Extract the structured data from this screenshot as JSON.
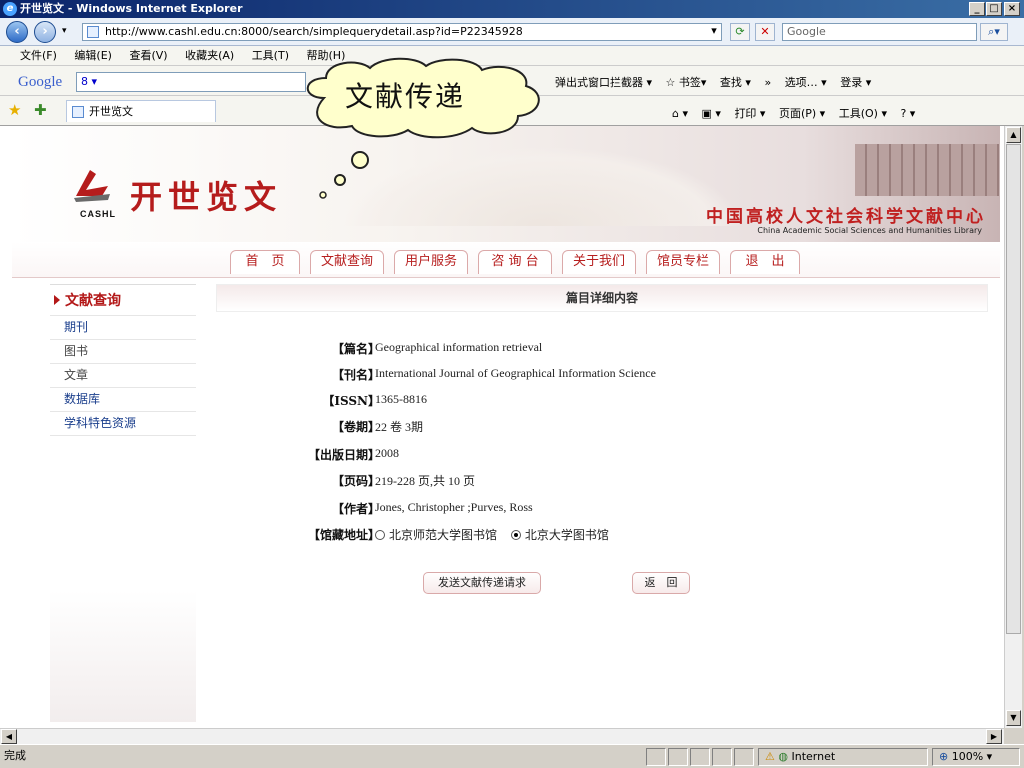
{
  "window": {
    "title": "开世览文 - Windows Internet Explorer",
    "ie_glyph": "e"
  },
  "address_bar": {
    "url": "http://www.cashl.edu.cn:8000/search/simplequerydetail.asp?id=P22345928",
    "search_placeholder": "Google"
  },
  "menu": [
    "文件(F)",
    "编辑(E)",
    "查看(V)",
    "收藏夹(A)",
    "工具(T)",
    "帮助(H)"
  ],
  "google_bar": {
    "logo": "Google",
    "input": "8 ▾",
    "items": [
      "弹出式窗口拦截器 ▾",
      "☆ 书签▾",
      "查找 ▾",
      "»",
      "选项… ▾",
      "登录 ▾"
    ]
  },
  "favorites_bar": {
    "tab_title": "开世览文",
    "tools": [
      "⌂ ▾",
      "▣ ▾",
      "打印 ▾",
      "页面(P) ▾",
      "工具(O) ▾",
      "? ▾"
    ]
  },
  "callout": {
    "text": "文献传递"
  },
  "site": {
    "logo_text": "开世览文",
    "logo_mark_text": "CASHL",
    "org_cn": "中国高校人文社会科学文献中心",
    "org_en": "China Academic Social Sciences and Humanities Library",
    "nav": [
      "首　页",
      "文献查询",
      "用户服务",
      "咨 询 台",
      "关于我们",
      "馆员专栏",
      "退　出"
    ]
  },
  "sidebar": {
    "heading": "文献查询",
    "items": [
      "期刊",
      "图书",
      "文章",
      "数据库",
      "学科特色资源"
    ]
  },
  "detail": {
    "heading": "篇目详细内容",
    "fields": [
      {
        "label": "【篇名】",
        "value": "Geographical information retrieval"
      },
      {
        "label": "【刊名】",
        "value": "International Journal of Geographical Information Science"
      },
      {
        "label": "【ISSN】",
        "value": "1365-8816"
      },
      {
        "label": "【卷期】",
        "value": "22 卷 3期"
      },
      {
        "label": "【出版日期】",
        "value": "2008"
      },
      {
        "label": "【页码】",
        "value": "219-228 页,共  10 页"
      },
      {
        "label": "【作者】",
        "value": "Jones, Christopher ;Purves, Ross"
      }
    ],
    "holding_label": "【馆藏地址】",
    "holdings": [
      {
        "name": "北京师范大学图书馆",
        "selected": false
      },
      {
        "name": "北京大学图书馆",
        "selected": true
      }
    ],
    "send_button": "发送文献传递请求",
    "back_button": "返　回"
  },
  "status_bar": {
    "text": "完成",
    "zone": "Internet",
    "zoom": "100%"
  }
}
